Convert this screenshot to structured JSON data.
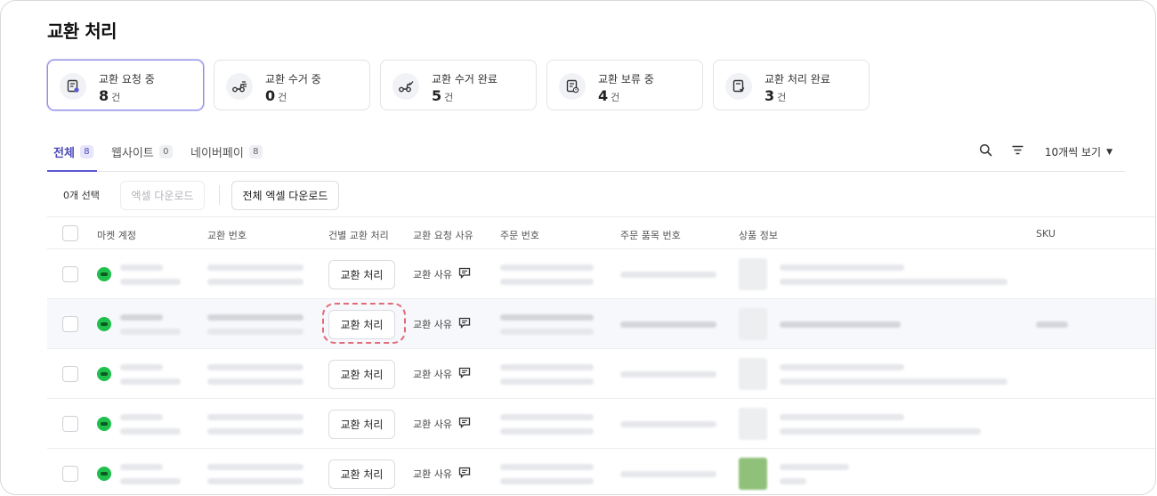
{
  "page": {
    "title": "교환 처리"
  },
  "cards": [
    {
      "label": "교환 요청 중",
      "count": "8",
      "unit": "건",
      "icon": "request-doc-icon"
    },
    {
      "label": "교환 수거 중",
      "count": "0",
      "unit": "건",
      "icon": "pickup-scooter-icon"
    },
    {
      "label": "교환 수거 완료",
      "count": "5",
      "unit": "건",
      "icon": "pickup-done-icon"
    },
    {
      "label": "교환 보류 중",
      "count": "4",
      "unit": "건",
      "icon": "hold-doc-icon"
    },
    {
      "label": "교환 처리 완료",
      "count": "3",
      "unit": "건",
      "icon": "complete-doc-icon"
    }
  ],
  "tabs": [
    {
      "label": "전체",
      "count": "8"
    },
    {
      "label": "웹사이트",
      "count": "0"
    },
    {
      "label": "네이버페이",
      "count": "8"
    }
  ],
  "toolbar": {
    "per_page": "10개씩 보기"
  },
  "actions": {
    "selected_count": "0개 선택",
    "excel_download": "엑셀 다운로드",
    "all_excel_download": "전체 엑셀 다운로드"
  },
  "table": {
    "columns": [
      "마켓 계정",
      "교환 번호",
      "건별 교환 처리",
      "교환 요청 사유",
      "주문 번호",
      "주문 품목 번호",
      "상품 정보",
      "SKU"
    ],
    "rows": [
      {
        "action": "교환 처리",
        "reason": "교환 사유"
      },
      {
        "action": "교환 처리",
        "reason": "교환 사유"
      },
      {
        "action": "교환 처리",
        "reason": "교환 사유"
      },
      {
        "action": "교환 처리",
        "reason": "교환 사유"
      },
      {
        "action": "교환 처리",
        "reason": "교환 사유"
      }
    ]
  },
  "colors": {
    "accent": "#5b57d1",
    "highlight_dash": "#e36a7a",
    "market_logo": "#1fbf4c"
  }
}
